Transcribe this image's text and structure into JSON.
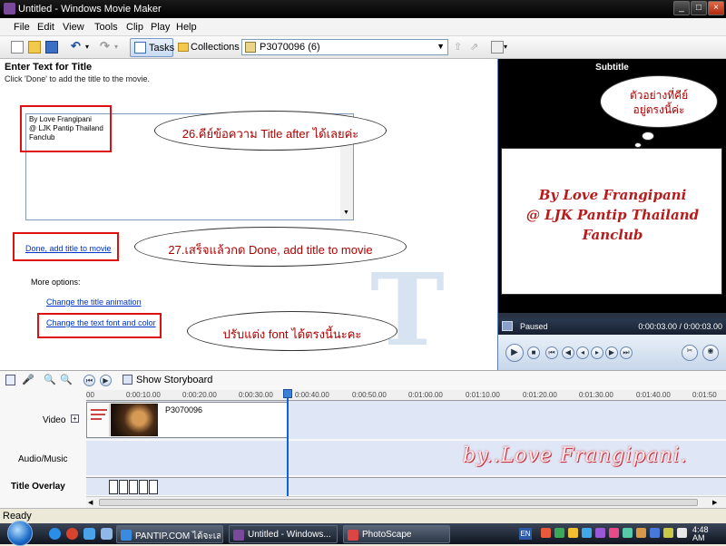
{
  "window": {
    "title": "Untitled - Windows Movie Maker",
    "buttons": [
      "_",
      "□",
      "×"
    ]
  },
  "menu": [
    "File",
    "Edit",
    "View",
    "Tools",
    "Clip",
    "Play",
    "Help"
  ],
  "toolbar": {
    "tasks_label": "Tasks",
    "collections_label": "Collections",
    "collection_value": "P3070096 (6)"
  },
  "taskpane": {
    "heading": "Enter Text for Title",
    "hint": "Click 'Done' to add the title to the movie.",
    "typed_text": "By Love Frangipani\n@ LJK Pantip Thailand\nFanclub",
    "done_link": "Done, add title to movie",
    "more_options": "More options:",
    "link_animation": "Change the title animation",
    "link_font": "Change the text font and color"
  },
  "callouts": {
    "c26": "26.คีย์ข้อความ Title after ได้เลยค่ะ",
    "c27": "27.เสร็จแล้วกด Done, add title to movie",
    "cfont": "ปรับแต่ง font ได้ตรงนี้นะคะ",
    "cpreview_1": "ตัวอย่างที่คีย์",
    "cpreview_2": "อยู่ตรงนี้ค่ะ"
  },
  "monitor": {
    "title": "Subtitle",
    "preview_lines": [
      "By Love Frangipani",
      "@ LJK Pantip Thailand",
      "Fanclub"
    ],
    "status": "Paused",
    "time": "0:00:03.00 / 0:00:03.00"
  },
  "timeline": {
    "show_storyboard": "Show Storyboard",
    "ticks": [
      "00",
      "0:00:10.00",
      "0:00:20.00",
      "0:00:30.00",
      "0:00:40.00",
      "0:00:50.00",
      "0:01:00.00",
      "0:01:10.00",
      "0:01:20.00",
      "0:01:30.00",
      "0:01:40.00",
      "0:01:50"
    ],
    "tracks": {
      "video": "Video",
      "audio": "Audio/Music",
      "overlay": "Title Overlay"
    },
    "clip_name": "P3070096",
    "watermark": "by..Love Frangipani."
  },
  "status": "Ready",
  "taskbar": {
    "tasks": [
      "PANTIP.COM ได้จะเล...",
      "Untitled - Windows...",
      "PhotoScape"
    ],
    "language": "EN",
    "clock": "4:48",
    "clock_ampm": "AM"
  }
}
